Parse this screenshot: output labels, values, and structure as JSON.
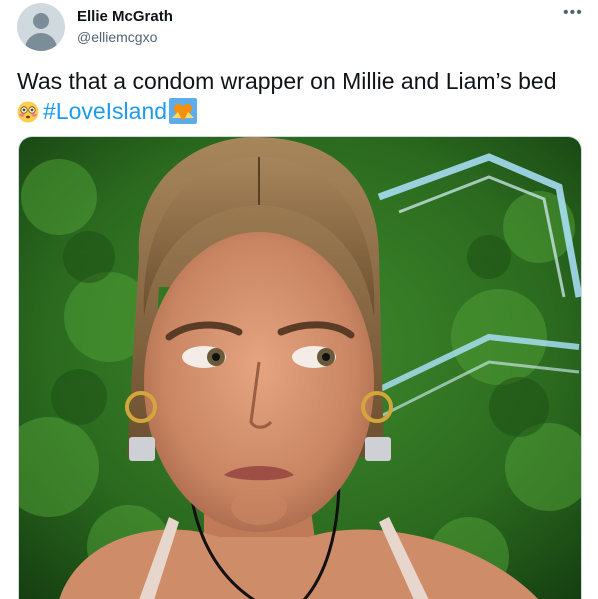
{
  "tweet": {
    "author_name": "Ellie McGrath",
    "author_handle": "@elliemcgxo",
    "more_icon": "more-horizontal-icon",
    "text_line1": "Was that a condom wrapper on Millie and Liam’s bed",
    "hashtag": "#LoveIsland",
    "emoji_1": "flushed-face-emoji",
    "emoji_2": "heart-hands-emoji",
    "colors": {
      "hashtag": "#1d9bf0",
      "secondary_text": "#536471"
    }
  },
  "media": {
    "icon": "photo-icon"
  }
}
